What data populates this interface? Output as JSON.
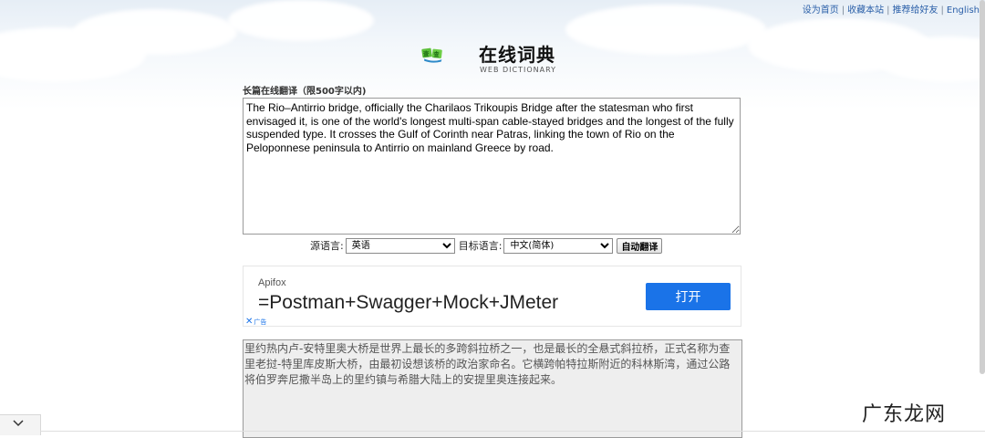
{
  "header": {
    "links": [
      "设为首页",
      "收藏本站",
      "推荐给好友",
      "English"
    ],
    "logo_text": "在线词典",
    "logo_sub": "WEB DICTIONARY"
  },
  "translator": {
    "label": "长篇在线翻译（限500字以内)",
    "source_text": "The Rio–Antirrio bridge, officially the Charilaos Trikoupis Bridge after the statesman who first envisaged it, is one of the world's longest multi-span cable-stayed bridges and the longest of the fully suspended type. It crosses the Gulf of Corinth near Patras, linking the town of Rio on the Peloponnese peninsula to Antirrio on mainland Greece by road.",
    "source_lang_label": "源语言:",
    "source_lang": "英语",
    "target_lang_label": "目标语言:",
    "target_lang": "中文(简体)",
    "auto_button": "自动翻译",
    "result_text": "里约热内卢-安特里奥大桥是世界上最长的多跨斜拉桥之一，也是最长的全悬式斜拉桥，正式名称为查里老挝-特里库皮斯大桥，由最初设想该桥的政治家命名。它横跨帕特拉斯附近的科林斯湾，通过公路将伯罗奔尼撒半岛上的里约镇与希腊大陆上的安提里奥连接起来。"
  },
  "ad": {
    "brand": "Apifox",
    "title": "=Postman+Swagger+Mock+JMeter",
    "button": "打开",
    "badge": "广告"
  },
  "watermark": "广东龙网",
  "colors": {
    "link": "#2a5fa8",
    "ad_button": "#1a73e8",
    "result_bg": "#eeeeee"
  },
  "icons": [
    "logo-icon",
    "close-x-icon",
    "chevron-down-icon",
    "resize-grip-icon"
  ]
}
